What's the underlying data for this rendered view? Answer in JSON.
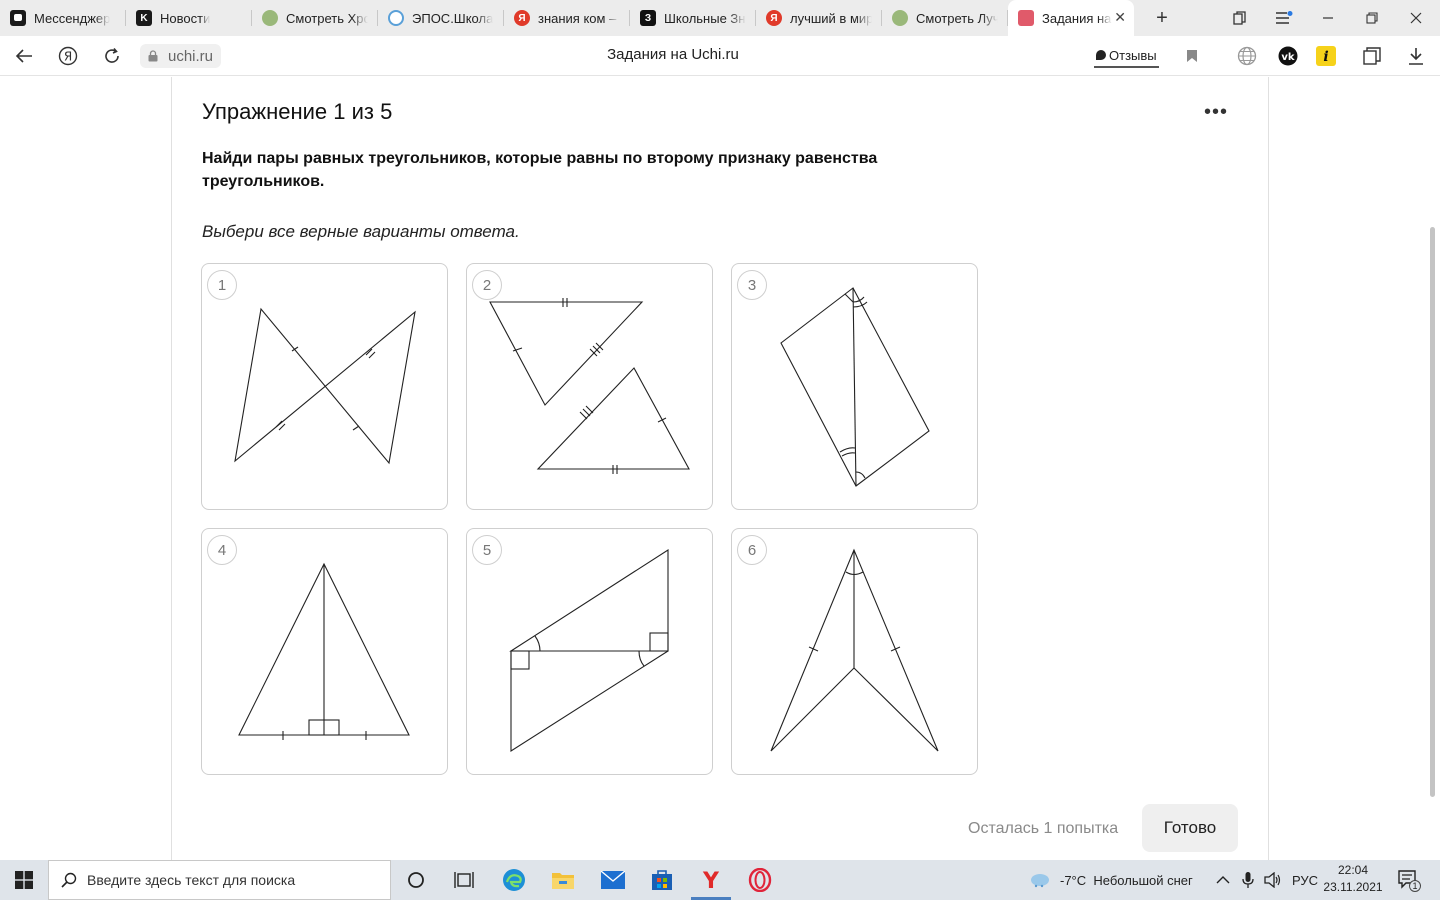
{
  "browser": {
    "tabs": [
      {
        "label": "Мессенджер",
        "icon": "messenger-icon",
        "color": "#1a1a1a"
      },
      {
        "label": "Новости",
        "icon": "vk-icon",
        "color": "#1a1a1a"
      },
      {
        "label": "Смотреть Хроники",
        "icon": "film-icon",
        "color": "#7a9a5a"
      },
      {
        "label": "ЭПОС.Школа",
        "icon": "epos-icon",
        "color": "#5aa0d8"
      },
      {
        "label": "знания ком – Google",
        "icon": "yandex-icon",
        "color": "#e03a2a"
      },
      {
        "label": "Школьные Знания",
        "icon": "znanija-icon",
        "color": "#111111"
      },
      {
        "label": "лучший в мире",
        "icon": "yandex-icon",
        "color": "#e03a2a"
      },
      {
        "label": "Смотреть Лучший",
        "icon": "film-icon",
        "color": "#7a9a5a"
      },
      {
        "label": "Задания на Uchi.ru",
        "icon": "uchi-icon",
        "color": "#e05a6a"
      }
    ],
    "url": "uchi.ru",
    "page_title": "Задания на Uchi.ru",
    "reviews_label": "Отзывы"
  },
  "exercise": {
    "title": "Упражнение 1 из 5",
    "task": "Найди пары равных треугольников, которые равны по второму признаку равенства треугольников.",
    "hint": "Выбери все верные варианты ответа.",
    "options": [
      "1",
      "2",
      "3",
      "4",
      "5",
      "6"
    ],
    "attempts_left": "Осталась 1 попытка",
    "done_label": "Готово"
  },
  "taskbar": {
    "search_placeholder": "Введите здесь текст для поиска",
    "weather": "-7°C  Небольшой снег",
    "language": "РУС",
    "time": "22:04",
    "date": "23.11.2021",
    "notification_count": "1"
  }
}
